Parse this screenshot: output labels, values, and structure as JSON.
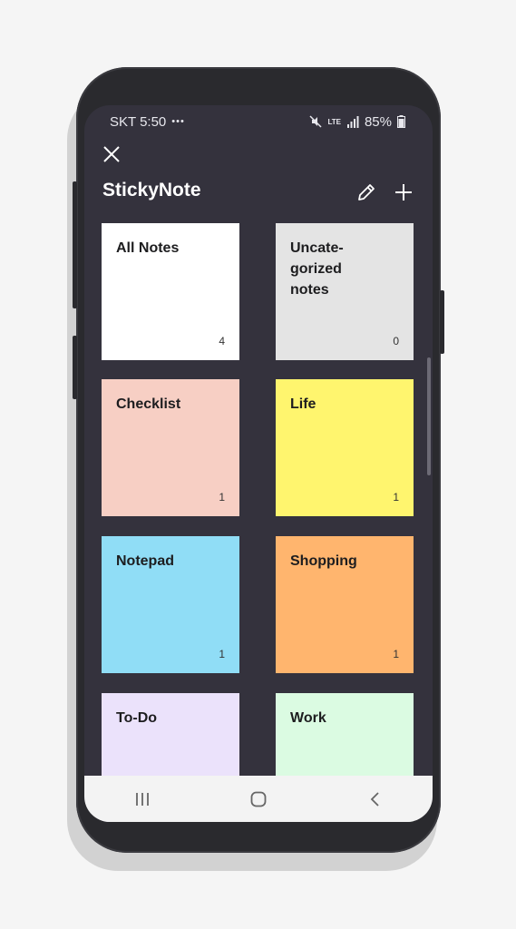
{
  "status_bar": {
    "carrier_time": "SKT 5:50",
    "overflow": "•••",
    "network": "LTE",
    "battery_percent": "85%"
  },
  "header": {
    "title": "StickyNote"
  },
  "icons": [
    "close-icon",
    "pencil-icon",
    "plus-icon",
    "recent-apps-icon",
    "home-icon",
    "back-icon",
    "mute-icon",
    "signal-icon",
    "battery-icon"
  ],
  "notes": [
    {
      "title": "All Notes",
      "count": "4",
      "color": "#ffffff"
    },
    {
      "title": "Uncate-\ngorized\nnotes",
      "count": "0",
      "color": "#e4e4e4"
    },
    {
      "title": "Checklist",
      "count": "1",
      "color": "#f7cfc4"
    },
    {
      "title": "Life",
      "count": "1",
      "color": "#fff56e"
    },
    {
      "title": "Notepad",
      "count": "1",
      "color": "#90ddf6"
    },
    {
      "title": "Shopping",
      "count": "1",
      "color": "#ffb56e"
    },
    {
      "title": "To-Do",
      "count": "",
      "color": "#ebe2fb"
    },
    {
      "title": "Work",
      "count": "",
      "color": "#dbfbe2"
    }
  ]
}
